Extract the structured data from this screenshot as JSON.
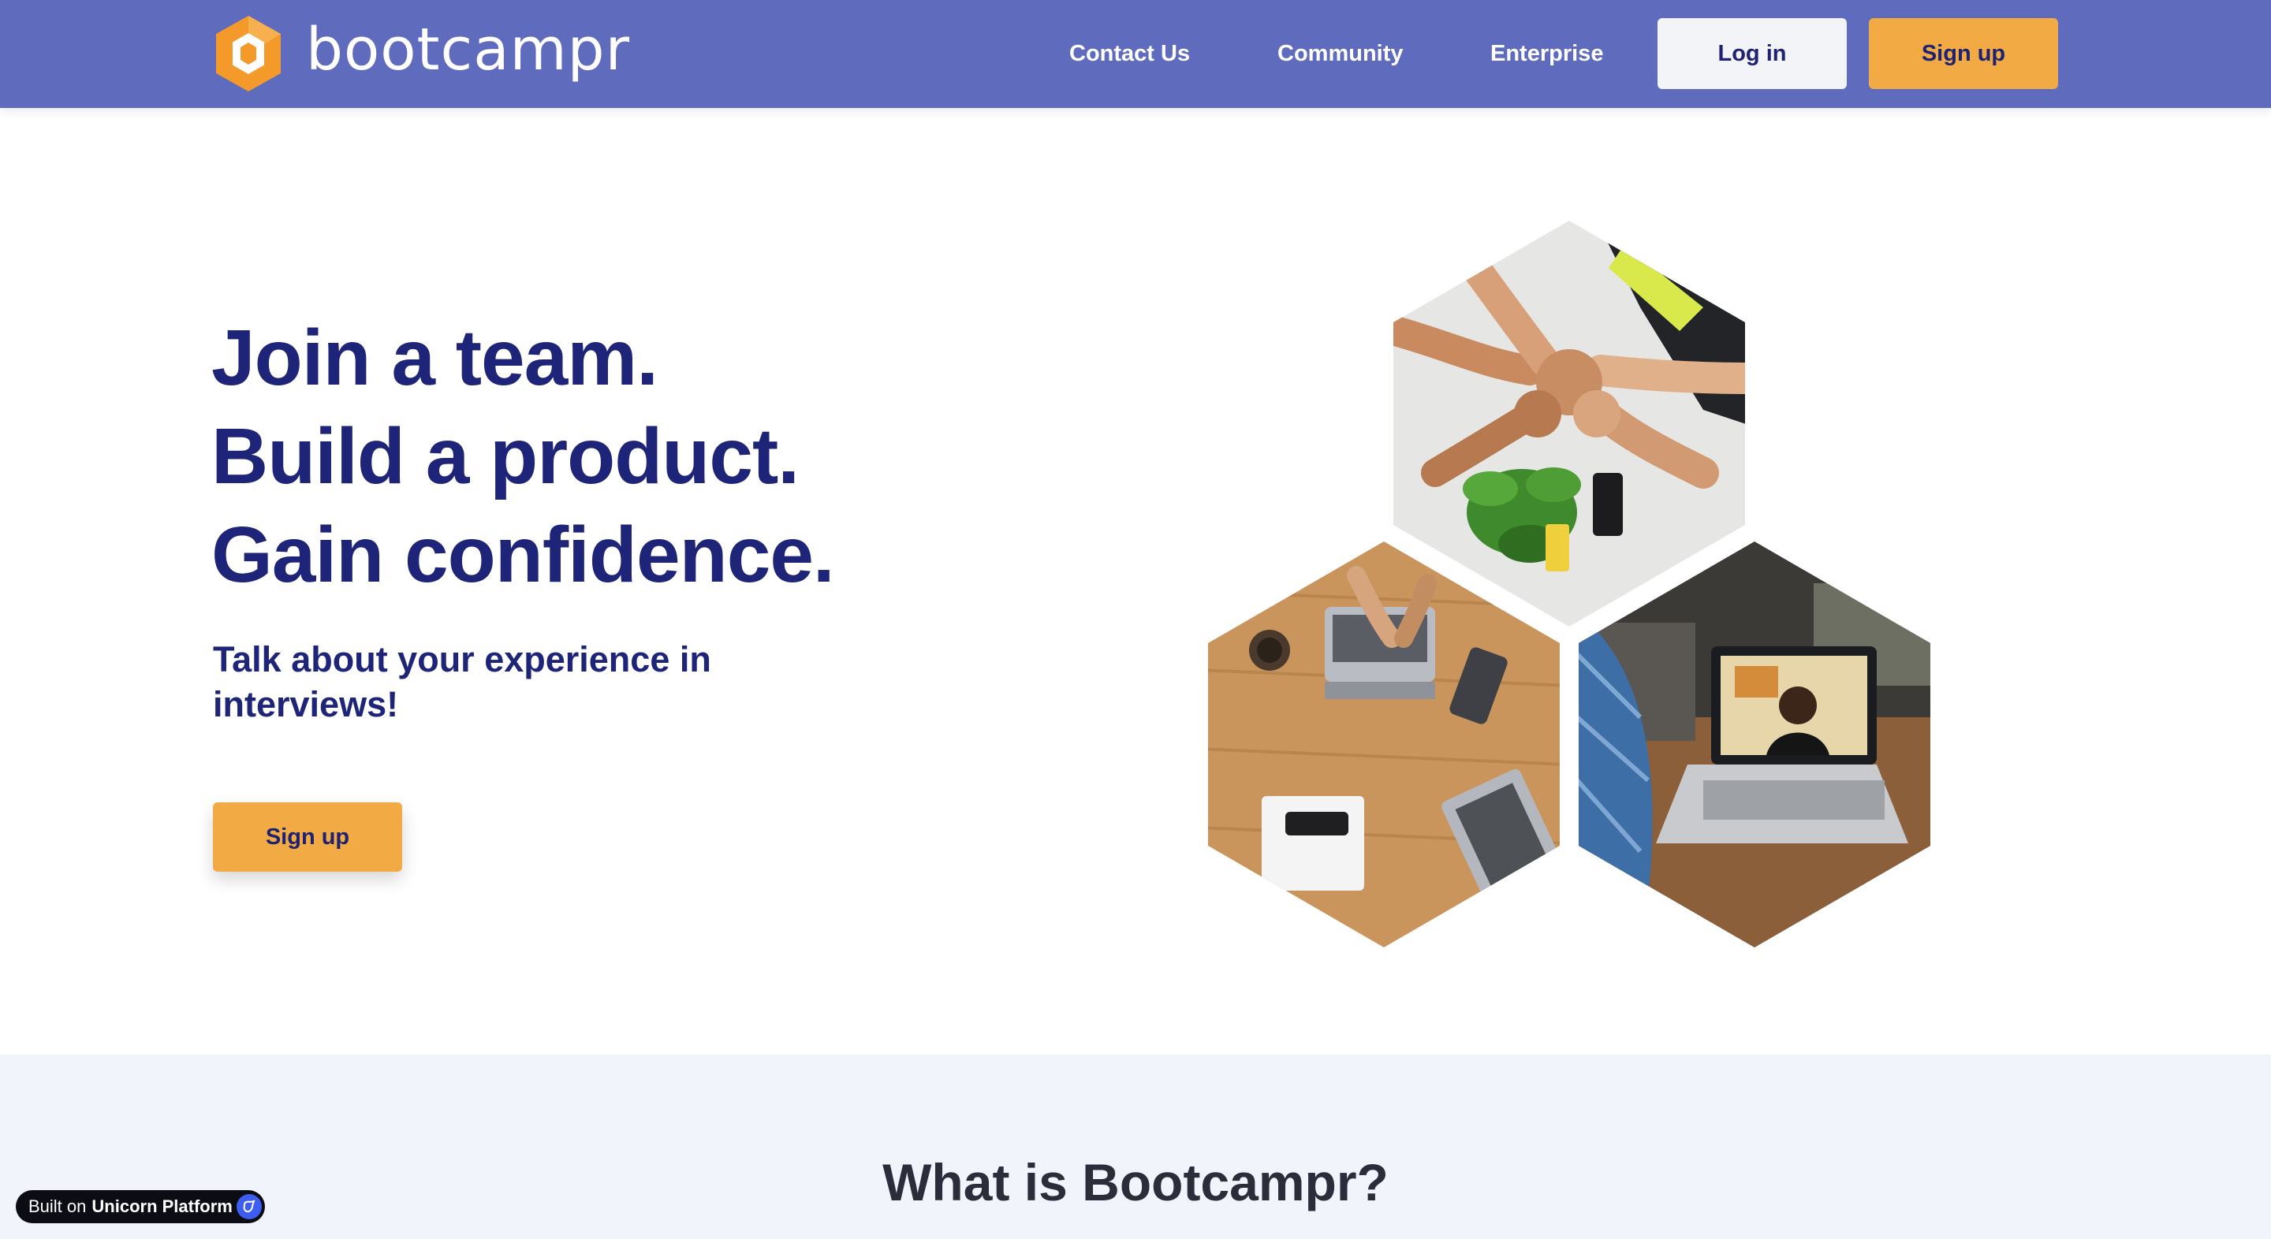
{
  "navbar": {
    "brand": "bootcampr",
    "links": [
      "Contact Us",
      "Community",
      "Enterprise"
    ],
    "login_label": "Log in",
    "signup_label": "Sign up"
  },
  "hero": {
    "headline": [
      "Join a team.",
      "Build a product.",
      "Gain confidence."
    ],
    "subtitle": "Talk about your experience in interviews!",
    "cta_label": "Sign up",
    "images": [
      "photo-fist-bump",
      "photo-laptops-table",
      "photo-video-call"
    ]
  },
  "section2": {
    "title": "What is Bootcampr?"
  },
  "badge": {
    "prefix": "Built on",
    "brand": "Unicorn Platform"
  },
  "colors": {
    "navbar_bg": "#5f6bbd",
    "accent_orange": "#f2aa45",
    "heading_navy": "#1e2478",
    "section_bg": "#f1f4fb"
  }
}
